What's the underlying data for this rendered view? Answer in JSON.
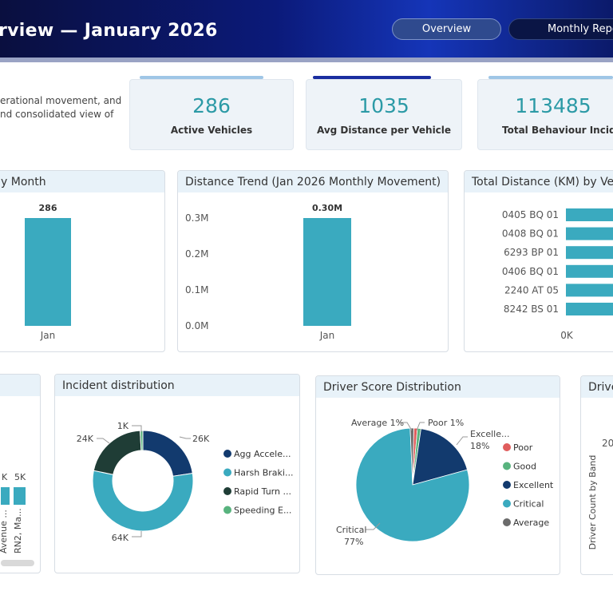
{
  "header": {
    "title": "rview — January 2026",
    "tabs": [
      {
        "label": "Overview",
        "active": true
      },
      {
        "label": "Monthly Repo",
        "active": false
      }
    ]
  },
  "intro": {
    "lines": [
      "erational movement, and",
      "nd consolidated view of"
    ]
  },
  "kpis": [
    {
      "value": "286",
      "label": "Active Vehicles",
      "accent": "#9fc6e6"
    },
    {
      "value": "1035",
      "label": "Avg Distance per Vehicle",
      "accent": "#1a2ea0"
    },
    {
      "value": "113485",
      "label": "Total Behaviour Incident",
      "accent": "#9fc6e6"
    }
  ],
  "colors": {
    "teal": "#3aaabf",
    "navy": "#123a6e",
    "dark_green": "#1f3d36",
    "light_green": "#58b37e",
    "red": "#e05d5d",
    "gray": "#6b6b6b"
  },
  "panels": {
    "vehicles_by_month": {
      "title": "y Month",
      "chart_data": {
        "type": "bar",
        "categories": [
          "Jan"
        ],
        "values": [
          286
        ],
        "data_labels": [
          "286"
        ]
      }
    },
    "distance_trend": {
      "title": "Distance Trend (Jan 2026 Monthly Movement)",
      "chart_data": {
        "type": "bar",
        "categories": [
          "Jan"
        ],
        "values": [
          300000
        ],
        "data_labels": [
          "0.30M"
        ],
        "ylim": [
          0,
          300000
        ],
        "yticks": [
          0,
          100000,
          200000,
          300000
        ],
        "ytick_labels": [
          "0.0M",
          "0.1M",
          "0.2M",
          "0.3M"
        ]
      }
    },
    "total_distance": {
      "title": "Total Distance (KM) by Vehic",
      "chart_data": {
        "type": "bar",
        "orientation": "horizontal",
        "categories": [
          "0405 BQ 01",
          "0408 BQ 01",
          "6293 BP 01",
          "0406 BQ 01",
          "2240 AT 05",
          "8242 BS 01"
        ],
        "xtick_labels": [
          "0K"
        ]
      }
    },
    "left_partial": {
      "chart_data": {
        "type": "bar",
        "data_labels": [
          "K",
          "5K"
        ],
        "categories": [
          "Avenue ...",
          "RN2, Ma..."
        ]
      }
    },
    "incident_distribution": {
      "title": "Incident distribution",
      "chart_data": {
        "type": "pie",
        "donut": true,
        "slices": [
          {
            "label": "Agg Accele...",
            "value": 26000,
            "display": "26K",
            "color": "#123a6e"
          },
          {
            "label": "Harsh Braki...",
            "value": 64000,
            "display": "64K",
            "color": "#3aaabf"
          },
          {
            "label": "Rapid Turn ...",
            "value": 24000,
            "display": "24K",
            "color": "#1f3d36"
          },
          {
            "label": "Speeding E...",
            "value": 1000,
            "display": "1K",
            "color": "#58b37e"
          }
        ]
      }
    },
    "driver_score": {
      "title": "Driver Score Distribution",
      "chart_data": {
        "type": "pie",
        "slices": [
          {
            "label": "Poor",
            "value": 1,
            "color": "#e05d5d"
          },
          {
            "label": "Good",
            "value": 1,
            "color": "#58b37e"
          },
          {
            "label": "Excellent",
            "value": 18,
            "color": "#123a6e"
          },
          {
            "label": "Critical",
            "value": 77,
            "color": "#3aaabf"
          },
          {
            "label": "Average",
            "value": 1,
            "color": "#6b6b6b"
          }
        ],
        "slice_labels": [
          {
            "label": "Average",
            "pct": "1%"
          },
          {
            "label": "Poor",
            "pct": "1%"
          },
          {
            "label": "Excelle...",
            "pct": "18%"
          },
          {
            "label": "Critical",
            "pct": "77%"
          }
        ]
      }
    },
    "driver_band": {
      "title": "Drive",
      "chart_data": {
        "type": "bar",
        "ylabel": "Driver Count by Band",
        "ytick_labels": [
          "20"
        ]
      }
    }
  }
}
